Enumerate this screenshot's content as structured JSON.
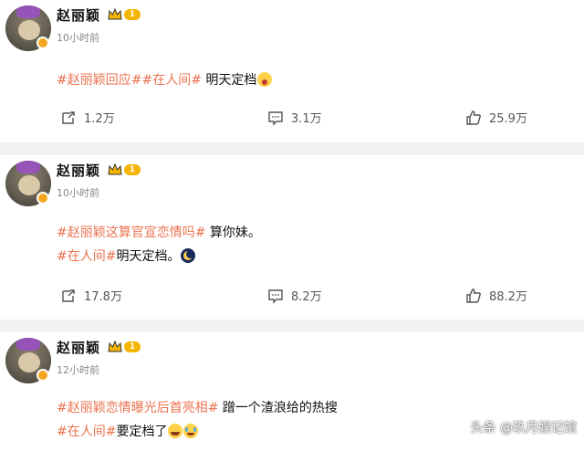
{
  "posts": [
    {
      "name": "赵丽颖",
      "vip_level": "1",
      "time": "10小时前",
      "line1": [
        {
          "text": "#赵丽颖回应##在人间#",
          "tag": true
        },
        {
          "text": " 明天定档",
          "tag": false
        }
      ],
      "line1_emoji": "crying-emoji",
      "line2": [],
      "repost": "1.2万",
      "comments": "3.1万",
      "likes": "25.9万"
    },
    {
      "name": "赵丽颖",
      "vip_level": "1",
      "time": "10小时前",
      "line1": [
        {
          "text": "#赵丽颖这算官宣恋情吗#",
          "tag": true
        },
        {
          "text": " 算你妹。",
          "tag": false
        }
      ],
      "line2": [
        {
          "text": "#在人间#",
          "tag": true
        },
        {
          "text": "明天定档。",
          "tag": false
        }
      ],
      "line2_emoji": "moon-emoji",
      "repost": "17.8万",
      "comments": "8.2万",
      "likes": "88.2万"
    },
    {
      "name": "赵丽颖",
      "vip_level": "1",
      "time": "12小时前",
      "line1": [
        {
          "text": "#赵丽颖恋情曝光后首亮相#",
          "tag": true
        },
        {
          "text": " 蹭一个渣浪给的热搜",
          "tag": false
        }
      ],
      "line2": [
        {
          "text": "#在人间#",
          "tag": true
        },
        {
          "text": "要定档了",
          "tag": false
        }
      ],
      "line2_emoji": "laughing-emoji"
    }
  ],
  "watermark": "头条 @玖月娱记馆",
  "colors": {
    "tag": "#eb7350",
    "vip": "#f4b400",
    "separator": "#f2f2f2"
  }
}
